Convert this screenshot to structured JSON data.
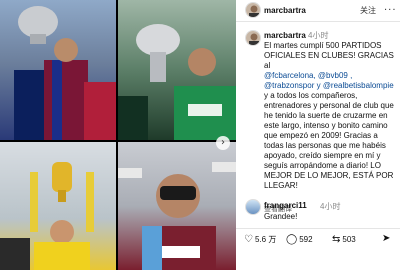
{
  "post": {
    "username": "marcbartra",
    "follow_label": "关注",
    "more_label": "...",
    "caption_time": "4小时",
    "caption_lines": [
      "El martes cumplí 500 PARTIDOS",
      "OFICIALES EN CLUBES! GRACIAS al",
      "@fcbarcelona, @bvb09 ,",
      "@trabzonspor y @realbetisbalompie",
      "y a todos los compañeros,",
      "entrenadores y personal de club que",
      "he tenido la suerte de cruzarme en",
      "este largo, intenso y bonito camino",
      "que empezó en 2009! Gracias a",
      "todas las personas que me habéis",
      "apoyado, creído siempre en mí y",
      "seguís arropándome a diario! LO",
      "MEJOR DE LO MEJOR, ESTÁ POR",
      "LLEGAR!"
    ],
    "translate_label": "查看翻译"
  },
  "comment": {
    "username": "frangarci11",
    "time": "4小时",
    "text": "Grandee!"
  },
  "actions": {
    "likes": "5.6 万",
    "comments": "592",
    "shares": "503"
  },
  "photos": {
    "panel1": {
      "tint": "#2a3a78"
    },
    "panel2": {
      "tint": "#1f3b2a"
    },
    "panel3": {
      "tint": "#e8c733"
    },
    "panel4": {
      "tint": "#7a1f2f"
    }
  },
  "colors": {
    "mention": "#0b4b94",
    "muted": "#888888"
  }
}
